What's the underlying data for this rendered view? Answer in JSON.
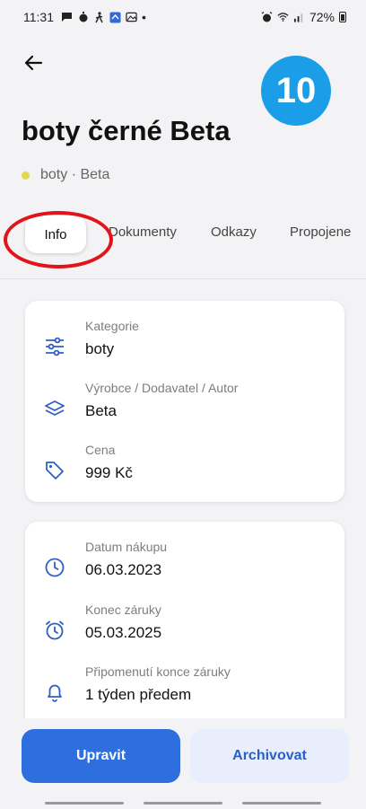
{
  "status_bar": {
    "time": "11:31",
    "dot": "•",
    "battery_percent": "72%"
  },
  "badge": {
    "number": "10"
  },
  "page": {
    "title": "boty černé Beta",
    "subtitle": "boty · Beta"
  },
  "tabs": [
    {
      "label": "Info",
      "active": true
    },
    {
      "label": "Dokumenty",
      "active": false
    },
    {
      "label": "Odkazy",
      "active": false
    },
    {
      "label": "Propojene",
      "active": false
    }
  ],
  "card1": {
    "rows": [
      {
        "label": "Kategorie",
        "value": "boty",
        "icon": "sliders-icon"
      },
      {
        "label": "Výrobce / Dodavatel / Autor",
        "value": "Beta",
        "icon": "layers-icon"
      },
      {
        "label": "Cena",
        "value": "999 Kč",
        "icon": "price-tag-icon"
      }
    ]
  },
  "card2": {
    "rows": [
      {
        "label": "Datum nákupu",
        "value": "06.03.2023",
        "icon": "clock-icon"
      },
      {
        "label": "Konec záruky",
        "value": "05.03.2025",
        "icon": "alarm-clock-icon"
      },
      {
        "label": "Připomenutí konce záruky",
        "value": "1 týden předem",
        "icon": "bell-icon"
      }
    ]
  },
  "actions": {
    "edit_label": "Upravit",
    "archive_label": "Archivovat"
  },
  "colors": {
    "primary": "#2e6fdd",
    "secondary_bg": "#e8eefc",
    "badge": "#1a9ee8",
    "annotation": "#e1141a",
    "category_dot": "#e6d84a"
  }
}
